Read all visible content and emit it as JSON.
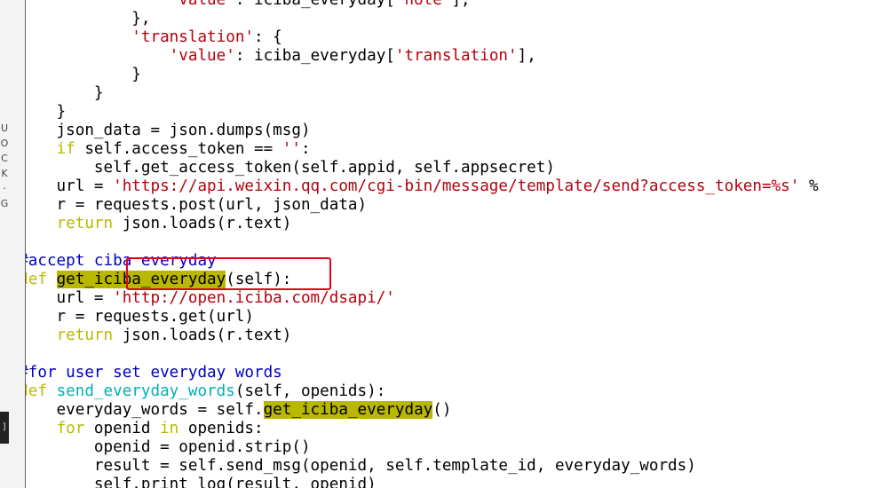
{
  "side_panel": {
    "letters": [
      "U",
      "O",
      "C",
      "K",
      "·",
      "G"
    ],
    "tab_label": "]"
  },
  "code_lines": [
    [
      {
        "t": "                  ",
        "c": ""
      },
      {
        "t": "'value'",
        "c": "str"
      },
      {
        "t": ": iciba_everyday[",
        "c": ""
      },
      {
        "t": "'note'",
        "c": "str"
      },
      {
        "t": "],",
        "c": ""
      }
    ],
    [
      {
        "t": "              },",
        "c": ""
      }
    ],
    [
      {
        "t": "              ",
        "c": ""
      },
      {
        "t": "'translation'",
        "c": "str"
      },
      {
        "t": ": {",
        "c": ""
      }
    ],
    [
      {
        "t": "                  ",
        "c": ""
      },
      {
        "t": "'value'",
        "c": "str"
      },
      {
        "t": ": iciba_everyday[",
        "c": ""
      },
      {
        "t": "'translation'",
        "c": "str"
      },
      {
        "t": "],",
        "c": ""
      }
    ],
    [
      {
        "t": "              }",
        "c": ""
      }
    ],
    [
      {
        "t": "          }",
        "c": ""
      }
    ],
    [
      {
        "t": "      }",
        "c": ""
      }
    ],
    [
      {
        "t": "      json_data = json.dumps(msg)",
        "c": ""
      }
    ],
    [
      {
        "t": "      ",
        "c": ""
      },
      {
        "t": "if",
        "c": "kw"
      },
      {
        "t": " self.access_token == ",
        "c": ""
      },
      {
        "t": "''",
        "c": "str"
      },
      {
        "t": ":",
        "c": ""
      }
    ],
    [
      {
        "t": "          self.get_access_token(self.appid, self.appsecret)",
        "c": ""
      }
    ],
    [
      {
        "t": "      url = ",
        "c": ""
      },
      {
        "t": "'https://api.weixin.qq.com/cgi-bin/message/template/send?access_token=%s'",
        "c": "str"
      },
      {
        "t": " %",
        "c": ""
      }
    ],
    [
      {
        "t": "      r = requests.post(url, json_data)",
        "c": ""
      }
    ],
    [
      {
        "t": "      ",
        "c": ""
      },
      {
        "t": "return",
        "c": "kw"
      },
      {
        "t": " json.loads(r.text)",
        "c": ""
      }
    ],
    [
      {
        "t": "",
        "c": ""
      }
    ],
    [
      {
        "t": "  ",
        "c": ""
      },
      {
        "t": "#accept ciba everyday",
        "c": "cm"
      }
    ],
    [
      {
        "t": "  ",
        "c": ""
      },
      {
        "t": "def",
        "c": "kw"
      },
      {
        "t": " ",
        "c": ""
      },
      {
        "t": "get_iciba_everyday",
        "c": "hl"
      },
      {
        "t": "(self):",
        "c": ""
      }
    ],
    [
      {
        "t": "      url = ",
        "c": ""
      },
      {
        "t": "'http://open.iciba.com/dsapi/'",
        "c": "str"
      }
    ],
    [
      {
        "t": "      r = requests.get(url)",
        "c": ""
      }
    ],
    [
      {
        "t": "      ",
        "c": ""
      },
      {
        "t": "return",
        "c": "kw"
      },
      {
        "t": " json.loads(r.text)",
        "c": ""
      }
    ],
    [
      {
        "t": "",
        "c": ""
      }
    ],
    [
      {
        "t": "  ",
        "c": ""
      },
      {
        "t": "#for user set everyday words",
        "c": "cm"
      }
    ],
    [
      {
        "t": "  ",
        "c": ""
      },
      {
        "t": "def",
        "c": "kw"
      },
      {
        "t": " ",
        "c": ""
      },
      {
        "t": "send_everyday_words",
        "c": "fn"
      },
      {
        "t": "(self, openids):",
        "c": ""
      }
    ],
    [
      {
        "t": "      everyday_words = self.",
        "c": ""
      },
      {
        "t": "get_iciba_everyday",
        "c": "hl"
      },
      {
        "t": "()",
        "c": ""
      }
    ],
    [
      {
        "t": "      ",
        "c": ""
      },
      {
        "t": "for",
        "c": "kw"
      },
      {
        "t": " openid ",
        "c": ""
      },
      {
        "t": "in",
        "c": "kw"
      },
      {
        "t": " openids:",
        "c": ""
      }
    ],
    [
      {
        "t": "          openid = openid.strip()",
        "c": ""
      }
    ],
    [
      {
        "t": "          result = self.send_msg(openid, self.template_id, everyday_words)",
        "c": ""
      }
    ],
    [
      {
        "t": "          self.print_log(result, openid)",
        "c": ""
      }
    ]
  ],
  "colors": {
    "keyword": "#b8ba00",
    "string": "#b5000c",
    "comment": "#0000c0",
    "function": "#00b0b4",
    "highlight": "#b9b700",
    "annotation_box": "#e3001a"
  }
}
